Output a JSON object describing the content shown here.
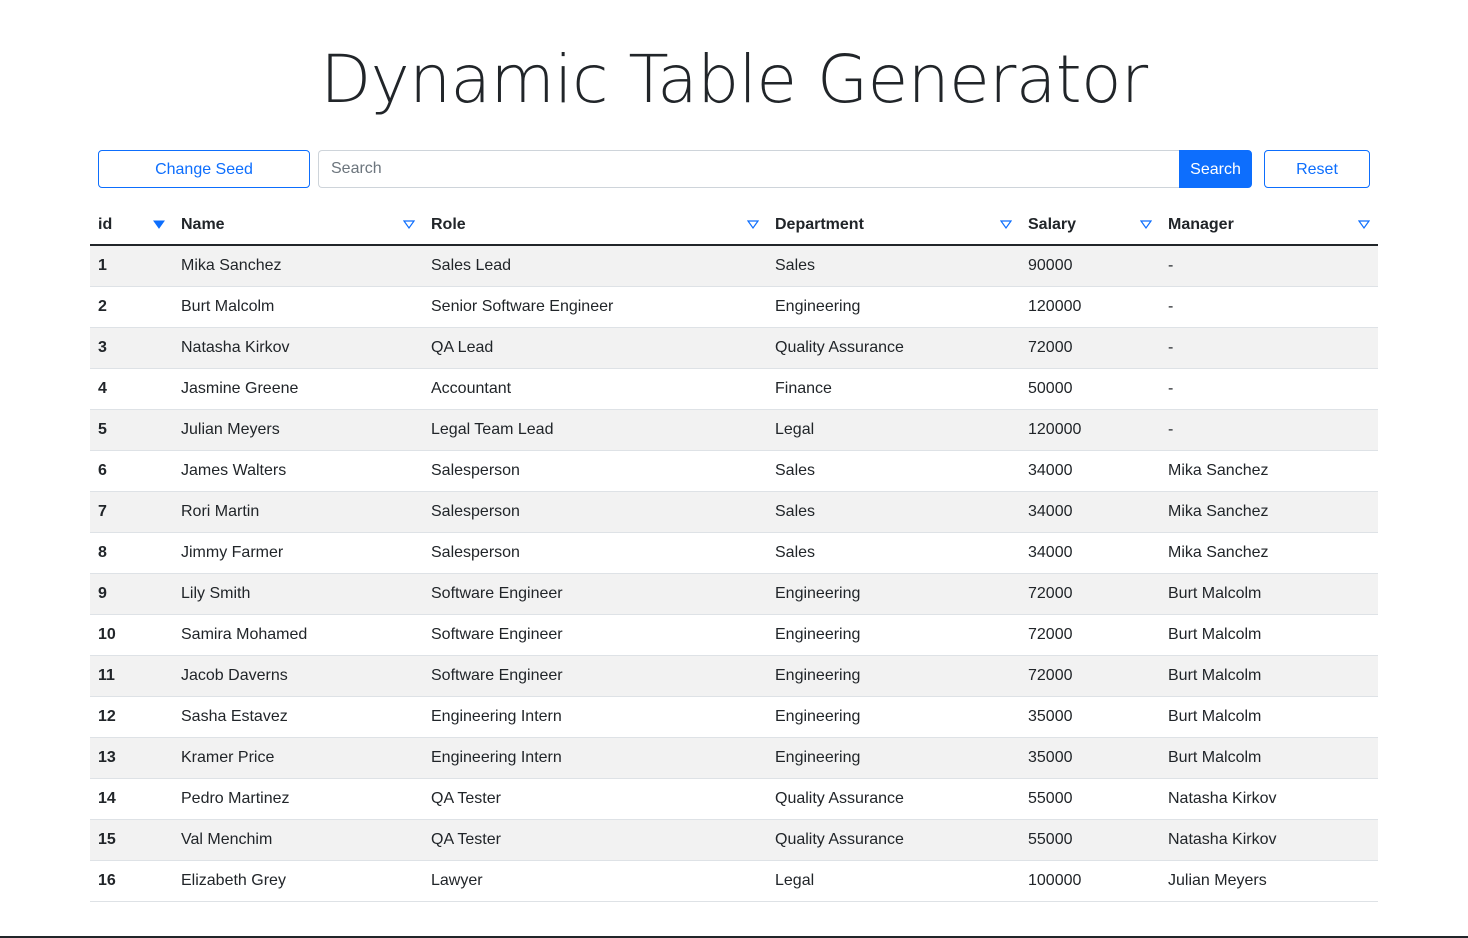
{
  "page": {
    "title": "Dynamic Table Generator"
  },
  "controls": {
    "change_seed_label": "Change Seed",
    "search_placeholder": "Search",
    "search_value": "",
    "search_button_label": "Search",
    "reset_label": "Reset"
  },
  "colors": {
    "accent": "#0d6efd",
    "stripe": "#f2f2f2",
    "text": "#212529"
  },
  "table": {
    "columns": [
      {
        "key": "id",
        "label": "id",
        "sort_icon": "caret-down-filled-icon"
      },
      {
        "key": "name",
        "label": "Name",
        "sort_icon": "caret-down-outline-icon"
      },
      {
        "key": "role",
        "label": "Role",
        "sort_icon": "caret-down-outline-icon"
      },
      {
        "key": "department",
        "label": "Department",
        "sort_icon": "caret-down-outline-icon"
      },
      {
        "key": "salary",
        "label": "Salary",
        "sort_icon": "caret-down-outline-icon"
      },
      {
        "key": "manager",
        "label": "Manager",
        "sort_icon": "caret-down-outline-icon"
      }
    ],
    "rows": [
      {
        "id": "1",
        "name": "Mika Sanchez",
        "role": "Sales Lead",
        "department": "Sales",
        "salary": "90000",
        "manager": "-"
      },
      {
        "id": "2",
        "name": "Burt Malcolm",
        "role": "Senior Software Engineer",
        "department": "Engineering",
        "salary": "120000",
        "manager": "-"
      },
      {
        "id": "3",
        "name": "Natasha Kirkov",
        "role": "QA Lead",
        "department": "Quality Assurance",
        "salary": "72000",
        "manager": "-"
      },
      {
        "id": "4",
        "name": "Jasmine Greene",
        "role": "Accountant",
        "department": "Finance",
        "salary": "50000",
        "manager": "-"
      },
      {
        "id": "5",
        "name": "Julian Meyers",
        "role": "Legal Team Lead",
        "department": "Legal",
        "salary": "120000",
        "manager": "-"
      },
      {
        "id": "6",
        "name": "James Walters",
        "role": "Salesperson",
        "department": "Sales",
        "salary": "34000",
        "manager": "Mika Sanchez"
      },
      {
        "id": "7",
        "name": "Rori Martin",
        "role": "Salesperson",
        "department": "Sales",
        "salary": "34000",
        "manager": "Mika Sanchez"
      },
      {
        "id": "8",
        "name": "Jimmy Farmer",
        "role": "Salesperson",
        "department": "Sales",
        "salary": "34000",
        "manager": "Mika Sanchez"
      },
      {
        "id": "9",
        "name": "Lily Smith",
        "role": "Software Engineer",
        "department": "Engineering",
        "salary": "72000",
        "manager": "Burt Malcolm"
      },
      {
        "id": "10",
        "name": "Samira Mohamed",
        "role": "Software Engineer",
        "department": "Engineering",
        "salary": "72000",
        "manager": "Burt Malcolm"
      },
      {
        "id": "11",
        "name": "Jacob Daverns",
        "role": "Software Engineer",
        "department": "Engineering",
        "salary": "72000",
        "manager": "Burt Malcolm"
      },
      {
        "id": "12",
        "name": "Sasha Estavez",
        "role": "Engineering Intern",
        "department": "Engineering",
        "salary": "35000",
        "manager": "Burt Malcolm"
      },
      {
        "id": "13",
        "name": "Kramer Price",
        "role": "Engineering Intern",
        "department": "Engineering",
        "salary": "35000",
        "manager": "Burt Malcolm"
      },
      {
        "id": "14",
        "name": "Pedro Martinez",
        "role": "QA Tester",
        "department": "Quality Assurance",
        "salary": "55000",
        "manager": "Natasha Kirkov"
      },
      {
        "id": "15",
        "name": "Val Menchim",
        "role": "QA Tester",
        "department": "Quality Assurance",
        "salary": "55000",
        "manager": "Natasha Kirkov"
      },
      {
        "id": "16",
        "name": "Elizabeth Grey",
        "role": "Lawyer",
        "department": "Legal",
        "salary": "100000",
        "manager": "Julian Meyers"
      }
    ]
  }
}
